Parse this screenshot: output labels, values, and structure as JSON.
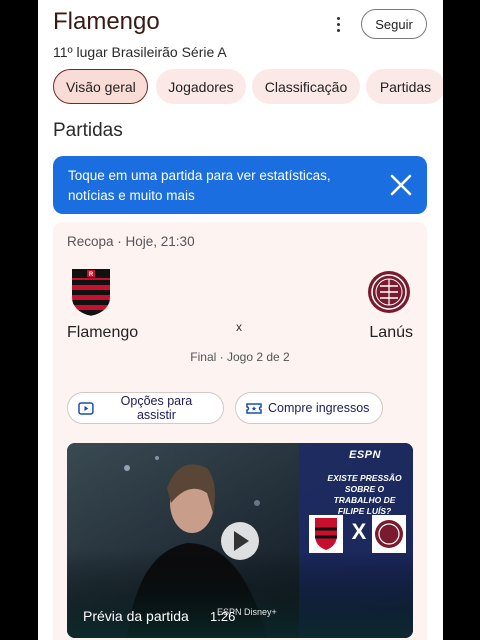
{
  "header": {
    "title": "Flamengo",
    "subtitle": "11º lugar Brasileirão Série A",
    "more_icon": "more-vert-icon",
    "follow_label": "Seguir"
  },
  "tabs": [
    {
      "label": "Visão geral",
      "active": true
    },
    {
      "label": "Jogadores",
      "active": false
    },
    {
      "label": "Classificação",
      "active": false
    },
    {
      "label": "Partidas",
      "active": false
    }
  ],
  "section_title": "Partidas",
  "banner": {
    "text": "Toque em uma partida para ver estatísticas, notícias e muito mais",
    "close_icon": "close-icon",
    "color": "#1a6ee0"
  },
  "match": {
    "meta": "Recopa · Hoje, 21:30",
    "home_team": "Flamengo",
    "away_team": "Lanús",
    "vs": "x",
    "stage": "Final · Jogo 2 de 2",
    "watch_label": "Opções para assistir",
    "tickets_label": "Compre ingressos",
    "home_crest_icon": "flamengo-crest-icon",
    "away_crest_icon": "lanus-crest-icon"
  },
  "video": {
    "label": "Prévia da partida",
    "duration": "1:26",
    "channel": "ESPN",
    "headline": "EXISTE PRESSÃO SOBRE O TRABALHO DE FILIPE LUÍS?",
    "vs_text": "X",
    "play_icon": "play-icon",
    "watermark": "ESPN Disney+"
  }
}
